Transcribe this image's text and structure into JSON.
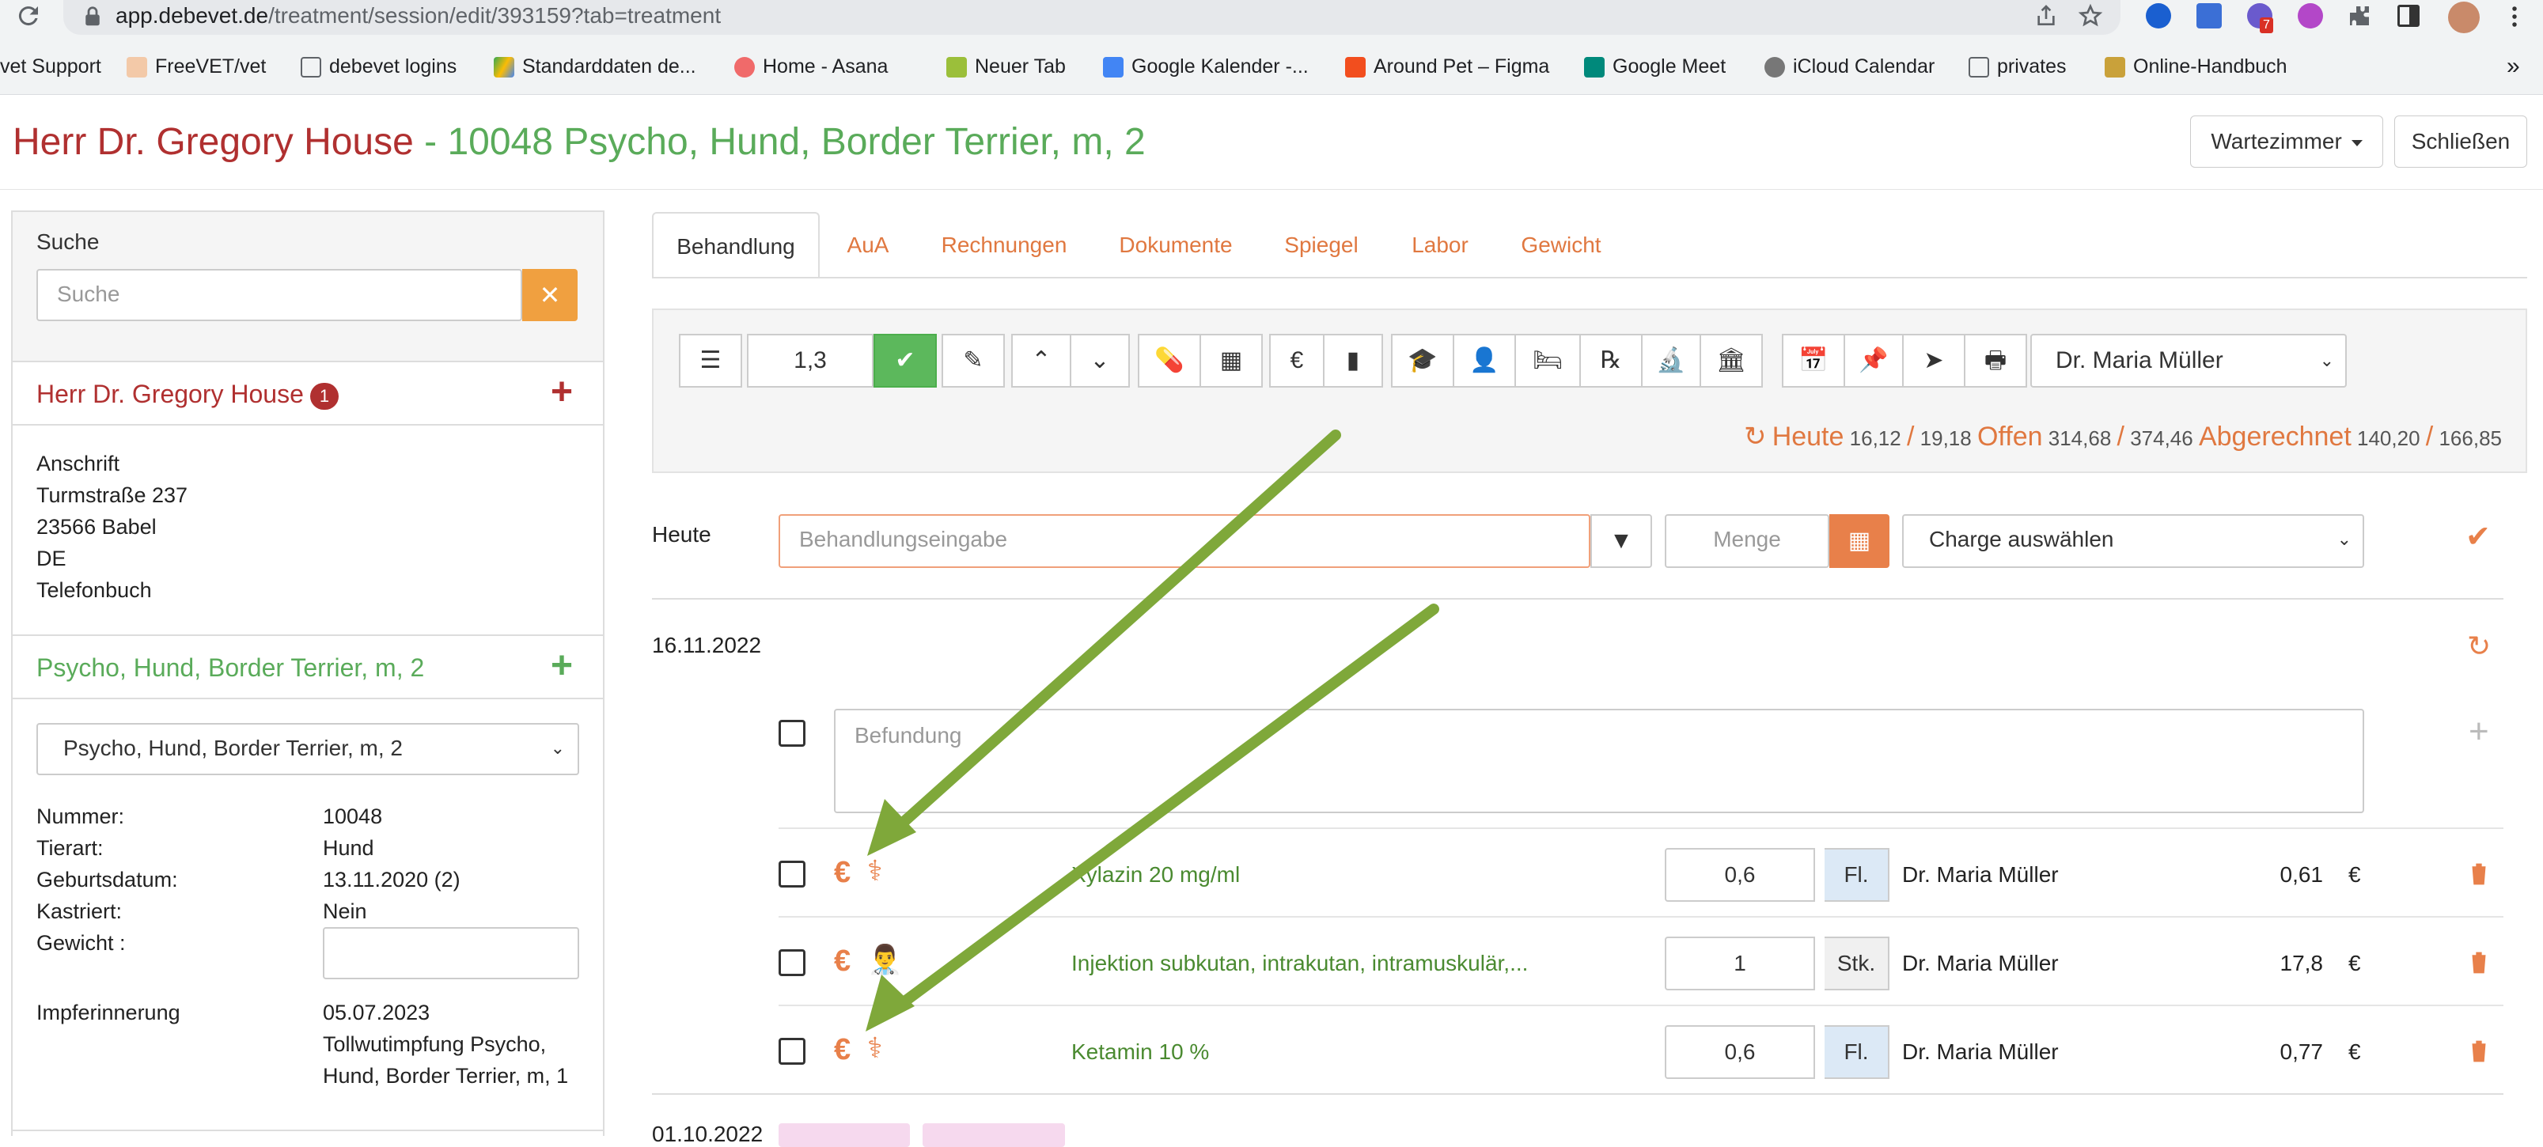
{
  "browser": {
    "url_host": "app.debevet.de",
    "url_path": "/treatment/session/edit/393159?tab=treatment",
    "bookmarks": [
      "vet Support",
      "FreeVET/vet",
      "debevet logins",
      "Standarddaten de...",
      "Home - Asana",
      "Neuer Tab",
      "Google Kalender -...",
      "Around Pet – Figma",
      "Google Meet",
      "iCloud Calendar",
      "privates",
      "Online-Handbuch"
    ],
    "more": "»",
    "ext_badge": "7"
  },
  "header": {
    "owner": "Herr Dr. Gregory House",
    "separator": " - ",
    "patient": "10048 Psycho, Hund, Border Terrier, m, 2",
    "waiting_room": "Wartezimmer",
    "close": "Schließen"
  },
  "sidebar": {
    "search_label": "Suche",
    "search_placeholder": "Suche",
    "owner_name": "Herr Dr. Gregory House",
    "owner_badge": "1",
    "address": [
      "Anschrift",
      "Turmstraße 237",
      "23566  Babel",
      "DE",
      "Telefonbuch"
    ],
    "pet_title": "Psycho, Hund, Border Terrier, m, 2",
    "pet_select": "Psycho, Hund, Border Terrier, m, 2",
    "details": [
      {
        "k": "Nummer:",
        "v": "10048"
      },
      {
        "k": "Tierart:",
        "v": "Hund"
      },
      {
        "k": "Geburtsdatum:",
        "v": "13.11.2020  (2)"
      },
      {
        "k": "Kastriert:",
        "v": "Nein"
      },
      {
        "k": "Gewicht :",
        "v": ""
      }
    ],
    "vacc_label": "Impferinnerung",
    "vacc_date": "05.07.2023",
    "vacc_text_1": "Tollwutimpfung Psycho,",
    "vacc_text_2": "Hund, Border Terrier, m, 1"
  },
  "tabs": [
    "Behandlung",
    "AuA",
    "Rechnungen",
    "Dokumente",
    "Spiegel",
    "Labor",
    "Gewicht"
  ],
  "toolbar": {
    "factor": "1,3",
    "euro": "€",
    "vet_select": "Dr. Maria Müller"
  },
  "stats": {
    "heute_label": "Heute",
    "heute_val": "16,12",
    "heute_total": "19,18",
    "offen_label": "Offen",
    "offen_val": "314,68",
    "offen_total": "374,46",
    "abg_label": "Abgerechnet",
    "abg_val": "140,20",
    "abg_total": "166,85",
    "slash": "/"
  },
  "entry": {
    "label": "Heute",
    "placeholder": "Behandlungseingabe",
    "qty_placeholder": "Menge",
    "charge": "Charge auswählen"
  },
  "session": {
    "date": "16.11.2022",
    "befund_placeholder": "Befundung",
    "euro": "€",
    "rows": [
      {
        "name": "Xylazin 20 mg/ml",
        "qty": "0,6",
        "unit": "Fl.",
        "doctor": "Dr. Maria Müller",
        "price": "0,61",
        "currency": "€"
      },
      {
        "name": "Injektion subkutan, intrakutan, intramuskulär,...",
        "qty": "1",
        "unit": "Stk.",
        "doctor": "Dr. Maria Müller",
        "price": "17,8",
        "currency": "€"
      },
      {
        "name": "Ketamin 10 %",
        "qty": "0,6",
        "unit": "Fl.",
        "doctor": "Dr. Maria Müller",
        "price": "0,77",
        "currency": "€"
      }
    ],
    "next_date": "01.10.2022"
  },
  "colors": {
    "owner": "#b03030",
    "patient": "#5aab5a",
    "accent": "#e07840",
    "arrow": "#7fa83a"
  }
}
